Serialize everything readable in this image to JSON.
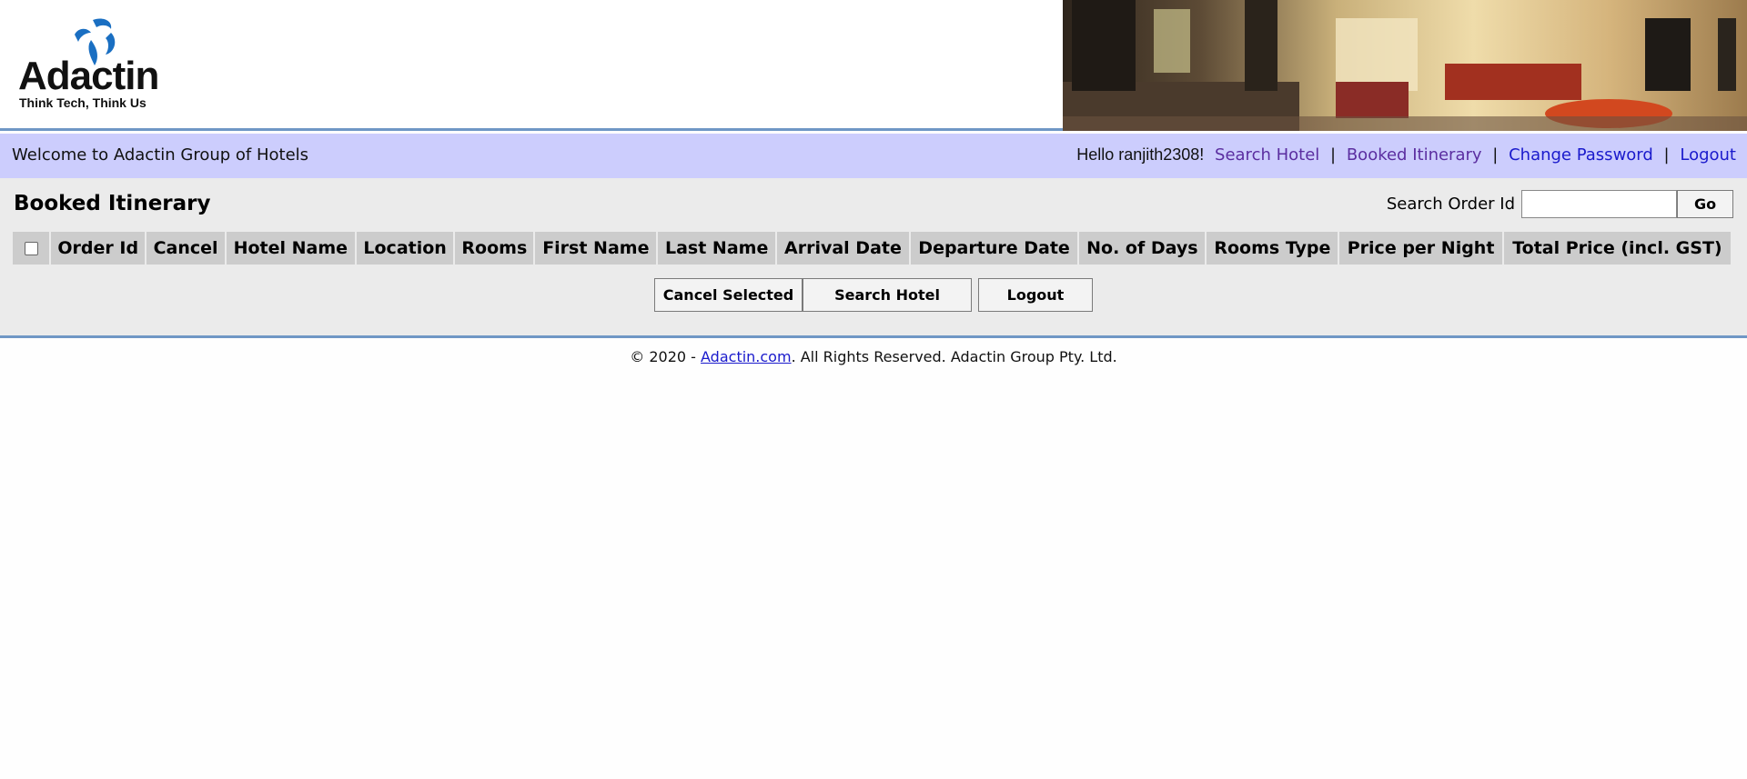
{
  "header": {
    "brand": "Adactin",
    "tagline": "Think Tech, Think Us",
    "banner_image": "hotel-lobby-photo"
  },
  "welcome": {
    "text": "Welcome to Adactin Group of Hotels",
    "hello": "Hello ranjith2308!",
    "nav": {
      "search_hotel": "Search Hotel",
      "booked_itinerary": "Booked Itinerary",
      "change_password": "Change Password",
      "logout": "Logout",
      "separator": "|"
    }
  },
  "main": {
    "title": "Booked Itinerary",
    "search_order_label": "Search Order Id",
    "search_order_value": "",
    "go_label": "Go",
    "columns": [
      "Order Id",
      "Cancel",
      "Hotel Name",
      "Location",
      "Rooms",
      "First Name",
      "Last Name",
      "Arrival Date",
      "Departure Date",
      "No. of Days",
      "Rooms Type",
      "Price per Night",
      "Total Price (incl. GST)"
    ],
    "buttons": {
      "cancel_selected": "Cancel Selected",
      "search_hotel": "Search Hotel",
      "logout": "Logout"
    }
  },
  "footer": {
    "prefix": "© 2020 - ",
    "link": "Adactin.com",
    "suffix": ". All Rights Reserved. Adactin Group Pty. Ltd."
  },
  "colors": {
    "welcome_bar": "#cccdfd",
    "panel": "#ebebeb",
    "header_cell": "#cccccc",
    "divider": "#6f97c5",
    "link": "#1a1acc",
    "visited_link": "#5b2ea0"
  }
}
